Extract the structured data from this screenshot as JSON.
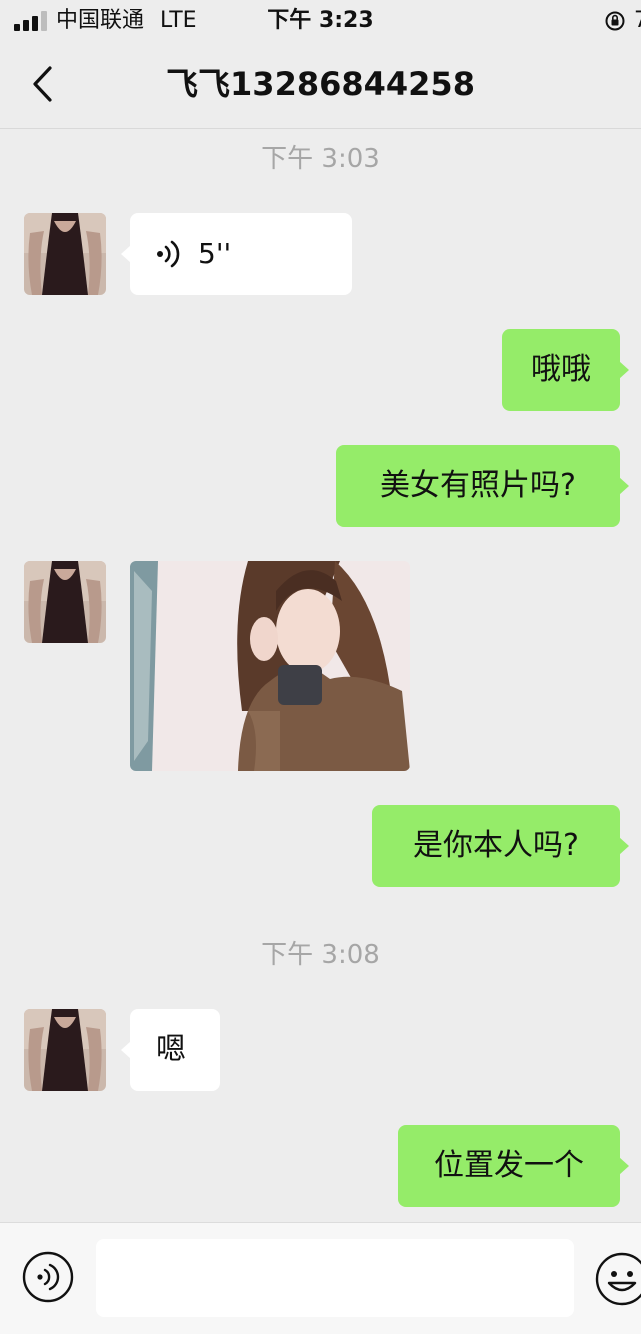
{
  "status_bar": {
    "carrier": "中国联通",
    "network": "LTE",
    "time": "下午 3:23",
    "battery_partial": "7"
  },
  "nav": {
    "title": "飞飞13286844258",
    "back_icon": "chevron-left-icon"
  },
  "messages": [
    {
      "kind": "timestamp",
      "text": "下午 3:03"
    },
    {
      "kind": "voice",
      "from": "contact",
      "duration": "5''"
    },
    {
      "kind": "text",
      "from": "me",
      "text": "哦哦"
    },
    {
      "kind": "text",
      "from": "me",
      "text": "美女有照片吗?"
    },
    {
      "kind": "image",
      "from": "contact"
    },
    {
      "kind": "text",
      "from": "me",
      "text": "是你本人吗?"
    },
    {
      "kind": "timestamp",
      "text": "下午 3:08"
    },
    {
      "kind": "text",
      "from": "contact",
      "text": "嗯"
    },
    {
      "kind": "text",
      "from": "me",
      "text": "位置发一个"
    }
  ],
  "input_bar": {
    "voice_icon": "voice-toggle-icon",
    "input_value": "",
    "emoji_icon": "smiley-face-icon"
  },
  "colors": {
    "background": "#ededed",
    "outgoing_bubble": "#95ec69",
    "incoming_bubble": "#ffffff",
    "timestamp_text": "#a6a6a6"
  }
}
